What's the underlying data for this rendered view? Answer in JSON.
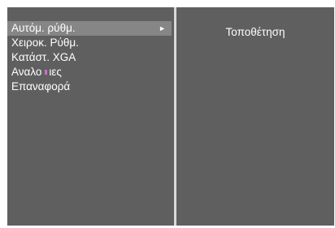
{
  "menu": {
    "items": [
      {
        "label": "Αυτόμ. ρύθμ.",
        "selected": true,
        "submenu_arrow": "►"
      },
      {
        "label": "Χειροκ. Ρύθμ.",
        "selected": false
      },
      {
        "label": "Κατάστ. XGA",
        "selected": false
      },
      {
        "label_prefix": "Αναλο",
        "label_suffix": "ιες",
        "selected": false
      },
      {
        "label": "Επαναφορά",
        "selected": false
      }
    ]
  },
  "detail": {
    "title": "Τοποθέτηση"
  },
  "colors": {
    "panel_bg": "#5f5f5f",
    "selected_bg": "#868686",
    "divider": "#d9d9d9",
    "text": "#ffffff"
  },
  "icons": {
    "submenu_arrow": "right-triangle-icon"
  }
}
